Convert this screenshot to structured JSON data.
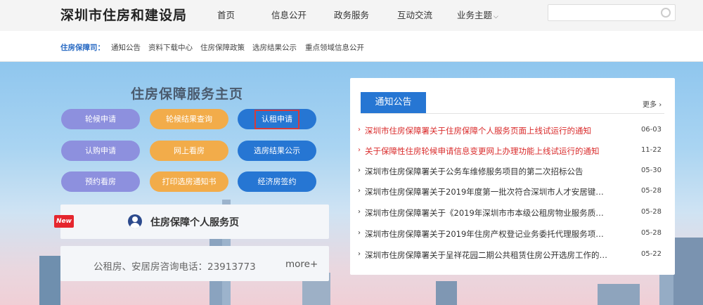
{
  "header": {
    "site_title": "深圳市住房和建设局",
    "nav": [
      "首页",
      "信息公开",
      "政务服务",
      "互动交流",
      "业务主题"
    ],
    "search_placeholder": ""
  },
  "breadcrumb": {
    "title": "住房保障司：",
    "links": [
      "通知公告",
      "资料下载中心",
      "住房保障政策",
      "选房结果公示",
      "重点领域信息公开"
    ]
  },
  "main": {
    "section_title": "住房保障服务主页",
    "buttons": [
      {
        "label": "轮候申请",
        "color": "purple"
      },
      {
        "label": "轮候结果查询",
        "color": "orange"
      },
      {
        "label": "认租申请",
        "color": "blue",
        "highlighted": true
      },
      {
        "label": "认购申请",
        "color": "purple"
      },
      {
        "label": "网上看房",
        "color": "orange"
      },
      {
        "label": "选房结果公示",
        "color": "blue"
      },
      {
        "label": "预约看房",
        "color": "purple"
      },
      {
        "label": "打印选房通知书",
        "color": "orange"
      },
      {
        "label": "经济房签约",
        "color": "blue"
      }
    ],
    "new_badge": "New",
    "personal_label": "住房保障个人服务页",
    "hotline_text": "公租房、安居房咨询电话：23913773",
    "hotline_more": "more+"
  },
  "notices": {
    "tab_label": "通知公告",
    "more_label": "更多",
    "items": [
      {
        "title": "深圳市住房保障署关于住房保障个人服务页面上线试运行的通知",
        "date": "06-03",
        "color": "red"
      },
      {
        "title": "关于保障性住房轮候申请信息变更网上办理功能上线试运行的通知",
        "date": "11-22",
        "color": "red"
      },
      {
        "title": "深圳市住房保障署关于公务车维修服务项目的第二次招标公告",
        "date": "05-30",
        "color": "black"
      },
      {
        "title": "深圳市住房保障署关于2019年度第一批次符合深圳市人才安居键…",
        "date": "05-28",
        "color": "black"
      },
      {
        "title": "深圳市住房保障署关于《2019年深圳市市本级公租房物业服务质…",
        "date": "05-28",
        "color": "black"
      },
      {
        "title": "深圳市住房保障署关于2019年住房产权登记业务委托代理服务项…",
        "date": "05-28",
        "color": "black"
      },
      {
        "title": "深圳市住房保障署关于呈祥花园二期公共租赁住房公开选房工作的…",
        "date": "05-22",
        "color": "black"
      }
    ]
  },
  "colors": {
    "accent_blue": "#2676d3",
    "notice_red": "#d92b2b",
    "pill_purple": "#8d90de",
    "pill_orange": "#f2ac4a",
    "new_red": "#e5262e"
  }
}
